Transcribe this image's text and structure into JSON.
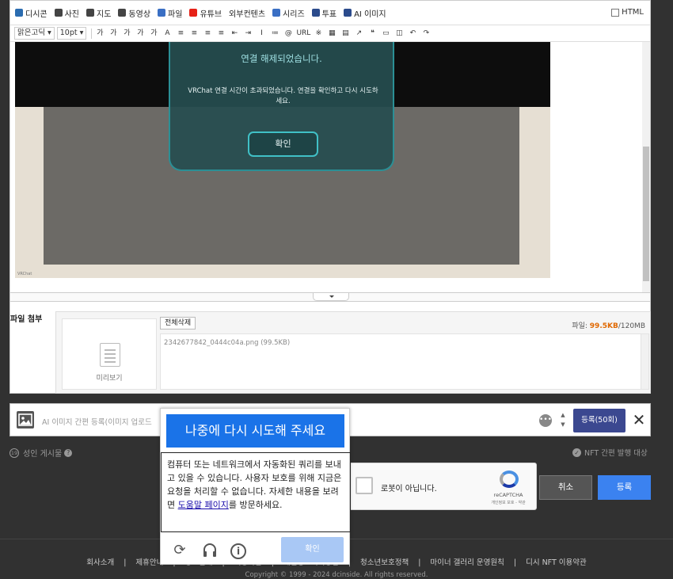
{
  "toolbar1": {
    "items": [
      {
        "label": "디시콘",
        "icon": "dccon-icon",
        "color": "#2b6cb0"
      },
      {
        "label": "사진",
        "icon": "photo-icon",
        "color": "#444444"
      },
      {
        "label": "지도",
        "icon": "map-pin-icon",
        "color": "#444444"
      },
      {
        "label": "동영상",
        "icon": "video-icon",
        "color": "#444444"
      },
      {
        "label": "파일",
        "icon": "file-icon",
        "color": "#3a6fc4"
      },
      {
        "label": "유튜브",
        "icon": "youtube-icon",
        "color": "#e62117"
      },
      {
        "label": "외부컨텐츠",
        "icon": "",
        "color": ""
      },
      {
        "label": "시리즈",
        "icon": "series-icon",
        "color": "#3a6fc4"
      },
      {
        "label": "투표",
        "icon": "vote-icon",
        "color": "#2b4b8c"
      },
      {
        "label": "AI 이미지",
        "icon": "ai-image-icon",
        "color": "#2b4b8c"
      }
    ],
    "html_label": "HTML"
  },
  "toolbar2": {
    "font_family": "맑은고딕",
    "font_size": "10pt",
    "buttons": [
      "가",
      "가",
      "가",
      "가",
      "가",
      "A",
      "≡",
      "≡",
      "≡",
      "≡",
      "⇤",
      "⇥",
      "I",
      "≔",
      "@",
      "URL",
      "※",
      "▦",
      "▤",
      "↗",
      "❝",
      "▭",
      "◫",
      "↶",
      "↷"
    ]
  },
  "editor": {
    "dialog_title": "연결 해제되었습니다.",
    "dialog_message": "VRChat 연결 시간이 초과되었습니다. 연결을 확인하고 다시 시도하세요.",
    "dialog_button": "확인",
    "image_caption": "VRChat"
  },
  "files": {
    "section_label": "파일 첨부",
    "preview_label": "미리보기",
    "delete_all": "전체삭제",
    "size_prefix": "파일: ",
    "size_used": "99.5KB",
    "size_total": "/120MB",
    "filename": "2342677842_0444c04a.png (99.5KB)"
  },
  "ai_bar": {
    "placeholder": "AI 이미지 간편 등록(이미지 업로드",
    "submit": "등록(50회)",
    "close": "✕",
    "more": "•••"
  },
  "adult": {
    "label": "성인 게시물",
    "badge": "19"
  },
  "nft": {
    "label": "NFT 간편 발행",
    "extra": "대상"
  },
  "recaptcha": {
    "label": "로봇이 아닙니다.",
    "brand": "reCAPTCHA",
    "terms": "개인정보 보호 - 약관"
  },
  "buttons": {
    "cancel": "취소",
    "submit": "등록"
  },
  "challenge": {
    "header": "나중에 다시 시도해 주세요",
    "body_pre": "컴퓨터 또는 네트워크에서 자동화된 쿼리를 보내고 있을 수 있습니다. 사용자 보호를 위해 지금은 요청을 처리할 수 없습니다. 자세한 내용을 보려면 ",
    "link": "도움말 페이지",
    "body_post": "를 방문하세요.",
    "verify": "확인"
  },
  "footer": {
    "links": [
      "회사소개",
      "제휴안내",
      "광고안내",
      "이용약관",
      "개인정보처리방침",
      "청소년보호정책",
      "마이너 갤러리 운영원칙",
      "디시 NFT 이용약관"
    ],
    "copyright": "Copyright © 1999 - 2024 dcinside. All rights reserved."
  },
  "colors": {
    "accent": "#3b82f0",
    "ai_submit": "#3b4890",
    "challenge_header": "#1a73e8",
    "dialog_teal": "#2b8f95"
  }
}
